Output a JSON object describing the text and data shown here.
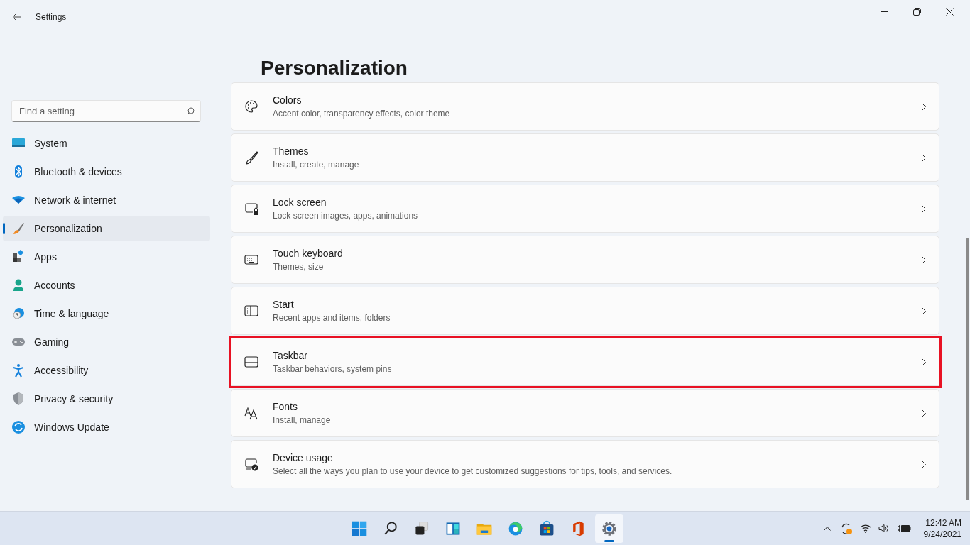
{
  "window": {
    "title": "Settings"
  },
  "search": {
    "placeholder": "Find a setting"
  },
  "sidebar": {
    "items": [
      {
        "label": "System",
        "selected": false
      },
      {
        "label": "Bluetooth & devices",
        "selected": false
      },
      {
        "label": "Network & internet",
        "selected": false
      },
      {
        "label": "Personalization",
        "selected": true
      },
      {
        "label": "Apps",
        "selected": false
      },
      {
        "label": "Accounts",
        "selected": false
      },
      {
        "label": "Time & language",
        "selected": false
      },
      {
        "label": "Gaming",
        "selected": false
      },
      {
        "label": "Accessibility",
        "selected": false
      },
      {
        "label": "Privacy & security",
        "selected": false
      },
      {
        "label": "Windows Update",
        "selected": false
      }
    ]
  },
  "page": {
    "title": "Personalization",
    "cards": [
      {
        "title": "Colors",
        "subtitle": "Accent color, transparency effects, color theme",
        "highlighted": false
      },
      {
        "title": "Themes",
        "subtitle": "Install, create, manage",
        "highlighted": false
      },
      {
        "title": "Lock screen",
        "subtitle": "Lock screen images, apps, animations",
        "highlighted": false
      },
      {
        "title": "Touch keyboard",
        "subtitle": "Themes, size",
        "highlighted": false
      },
      {
        "title": "Start",
        "subtitle": "Recent apps and items, folders",
        "highlighted": false
      },
      {
        "title": "Taskbar",
        "subtitle": "Taskbar behaviors, system pins",
        "highlighted": true
      },
      {
        "title": "Fonts",
        "subtitle": "Install, manage",
        "highlighted": false
      },
      {
        "title": "Device usage",
        "subtitle": "Select all the ways you plan to use your device to get customized suggestions for tips, tools, and services.",
        "highlighted": false
      }
    ]
  },
  "taskbar": {
    "apps": [
      {
        "selected": false
      },
      {
        "selected": false
      },
      {
        "selected": false
      },
      {
        "selected": false
      },
      {
        "selected": false
      },
      {
        "selected": false
      },
      {
        "selected": false
      },
      {
        "selected": false
      },
      {
        "selected": true
      }
    ],
    "clock": {
      "time": "12:42 AM",
      "date": "9/24/2021"
    }
  }
}
